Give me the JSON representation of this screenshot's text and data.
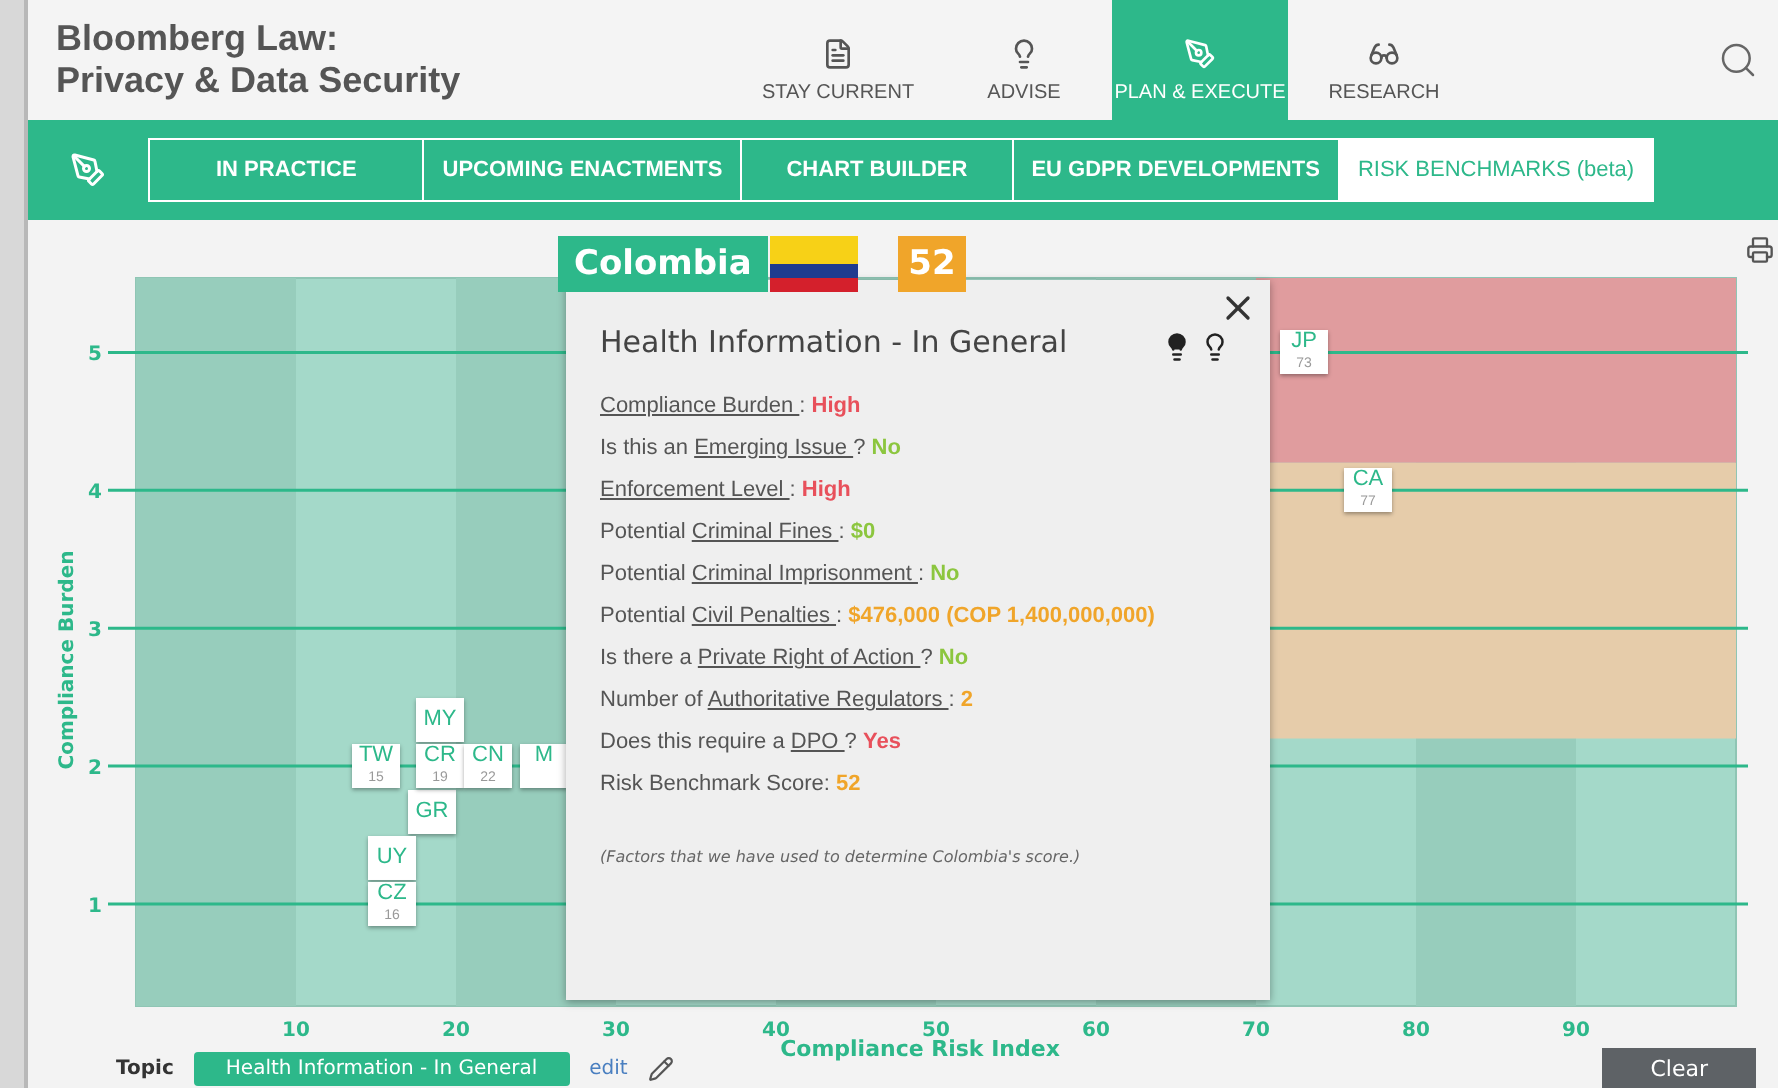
{
  "app": {
    "title_lines": [
      "Bloomberg Law:",
      "Privacy & Data Security"
    ]
  },
  "main_nav": [
    {
      "label": "STAY CURRENT",
      "kind": "document",
      "selected": false
    },
    {
      "label": "ADVISE",
      "kind": "bulb",
      "selected": false
    },
    {
      "label": "PLAN & EXECUTE",
      "kind": "compass",
      "selected": true
    },
    {
      "label": "RESEARCH",
      "kind": "glasses",
      "selected": false
    }
  ],
  "sub_nav": [
    {
      "label": "IN PRACTICE",
      "selected": false
    },
    {
      "label": "UPCOMING ENACTMENTS",
      "selected": false
    },
    {
      "label": "CHART BUILDER",
      "selected": false
    },
    {
      "label": "EU GDPR DEVELOPMENTS",
      "selected": false
    },
    {
      "label": "RISK BENCHMARKS (beta)",
      "selected": true
    }
  ],
  "chart": {
    "chart_data": {
      "type": "scatter",
      "xlabel": "Compliance Risk Index",
      "ylabel": "Compliance Burden",
      "xticks": [
        10,
        20,
        30,
        40,
        50,
        60,
        70,
        80,
        90
      ],
      "yticks": [
        1,
        2,
        3,
        4,
        5
      ],
      "grid": true,
      "xlim": [
        0,
        100
      ],
      "ylim": [
        0.26,
        5.54
      ],
      "bands": [
        {
          "axis": "x",
          "from": 0,
          "to": 10,
          "color": "#97cdbc"
        },
        {
          "axis": "x",
          "from": 20,
          "to": 30,
          "color": "#97cdbc"
        },
        {
          "axis": "x",
          "from": 40,
          "to": 50,
          "color": "#97cdbc"
        },
        {
          "axis": "x",
          "from": 60,
          "to": 70,
          "color": "#97cdbc"
        },
        {
          "axis": "x",
          "from": 80,
          "to": 90,
          "color": "#97cdbc"
        },
        {
          "axis": "y",
          "from": 4.2,
          "to": 5.54,
          "color": "#e09c9e"
        },
        {
          "axis": "y",
          "from": 2.2,
          "to": 4.2,
          "color": "#e6ccaa"
        }
      ],
      "x": [
        15,
        18.5,
        16,
        16,
        19,
        19,
        22,
        25.5,
        73,
        77
      ],
      "series": [
        {
          "color": "#ffffff",
          "values": [
            2,
            1.66,
            1.33,
            1,
            2.33,
            2,
            2,
            2,
            5,
            4
          ]
        }
      ],
      "annotations": [
        {
          "x": 15,
          "y": 2.07,
          "text": "TW"
        },
        {
          "x": 15,
          "y": 1.91,
          "text": "15"
        },
        {
          "x": 18.5,
          "y": 1.66,
          "text": "GR"
        },
        {
          "x": 16,
          "y": 1.33,
          "text": "UY"
        },
        {
          "x": 16,
          "y": 1.07,
          "text": "CZ"
        },
        {
          "x": 16,
          "y": 0.91,
          "text": "16"
        },
        {
          "x": 19,
          "y": 2.33,
          "text": "MY"
        },
        {
          "x": 19,
          "y": 2.07,
          "text": "CR"
        },
        {
          "x": 19,
          "y": 1.91,
          "text": "19"
        },
        {
          "x": 22,
          "y": 2.07,
          "text": "CN"
        },
        {
          "x": 22,
          "y": 1.91,
          "text": "22"
        },
        {
          "x": 25.5,
          "y": 2.07,
          "text": "M"
        },
        {
          "x": 73,
          "y": 5.07,
          "text": "JP"
        },
        {
          "x": 73,
          "y": 4.91,
          "text": "73"
        },
        {
          "x": 77,
          "y": 4.07,
          "text": "CA"
        },
        {
          "x": 77,
          "y": 3.91,
          "text": "77"
        }
      ]
    }
  },
  "popup": {
    "country": "Colombia",
    "score": "52",
    "title": "Health Information - In General",
    "facts": [
      {
        "term": "Compliance Burden ",
        "suffix": ": ",
        "value": "High",
        "color": "#e8505b"
      },
      {
        "prefix": "Is this an ",
        "term": "Emerging Issue ",
        "suffix": "? ",
        "value": "No",
        "color": "#8cc63f"
      },
      {
        "term": "Enforcement Level ",
        "suffix": ": ",
        "value": "High",
        "color": "#e8505b"
      },
      {
        "prefix": "Potential ",
        "term": "Criminal Fines ",
        "suffix": ": ",
        "value": "$0",
        "color": "#8cc63f"
      },
      {
        "prefix": "Potential ",
        "term": "Criminal Imprisonment ",
        "suffix": ": ",
        "value": "No",
        "color": "#8cc63f"
      },
      {
        "prefix": "Potential ",
        "term": "Civil Penalties ",
        "suffix": ": ",
        "value": "$476,000 (COP 1,400,000,000)",
        "color": "#f0a52a"
      },
      {
        "prefix": "Is there a ",
        "term": "Private Right of Action ",
        "suffix": "? ",
        "value": "No",
        "color": "#8cc63f"
      },
      {
        "prefix": "Number of ",
        "term": "Authoritative Regulators ",
        "suffix": ": ",
        "value": "2",
        "color": "#f0a52a"
      },
      {
        "prefix": "Does this require a ",
        "term": "DPO ",
        "suffix": "? ",
        "value": "Yes",
        "color": "#e8505b"
      },
      {
        "prefix": "Risk Benchmark Score: ",
        "value": "52",
        "color": "#f0a52a"
      }
    ],
    "footnote": "(Factors that we have used to determine Colombia's score.)"
  },
  "topic": {
    "label": "Topic",
    "value": "Health Information - In General",
    "edit": "edit"
  },
  "clear_button": "Clear"
}
